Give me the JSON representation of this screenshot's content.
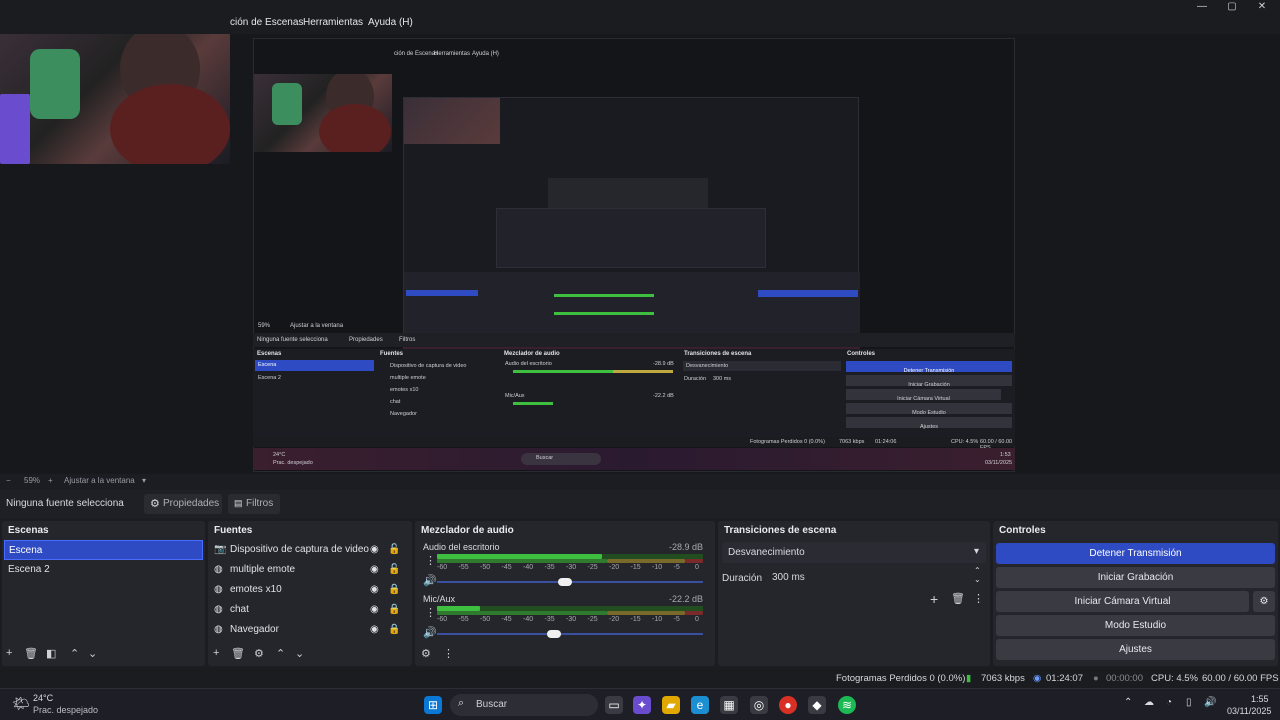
{
  "menu": {
    "item_scenes": "ción de Escenas",
    "item_tools": "Herramientas",
    "item_help": "Ayuda (H)"
  },
  "window_controls": {
    "minimize": "—",
    "maximize": "▢",
    "close": "✕"
  },
  "nested_preview": {
    "menu_scenes": "ción de Escenas",
    "menu_tools": "Herramientas",
    "menu_help": "Ayuda (H)",
    "zoom": "59%",
    "fit": "Ajustar a la ventana",
    "no_source": "Ninguna fuente selecciona",
    "properties": "Propiedades",
    "filters": "Filtros",
    "scenes_title": "Escenas",
    "scene1": "Escena",
    "scene2": "Escena 2",
    "sources_title": "Fuentes",
    "sources": [
      "Dispositivo de captura de video",
      "multiple emote",
      "emotes x10",
      "chat",
      "Navegador"
    ],
    "mixer_title": "Mezclador de audio",
    "desktop_audio": "Audio del escritorio",
    "desktop_db": "-28.9 dB",
    "mic": "Mic/Aux",
    "mic_db": "-22.2 dB",
    "transitions_title": "Transiciones de escena",
    "transition": "Desvanecimiento",
    "duration_label": "Duración",
    "duration": "300 ms",
    "controls_title": "Controles",
    "buttons": [
      "Detener Transmisión",
      "Iniciar Grabación",
      "Iniciar Cámara Virtual",
      "Modo Estudio",
      "Ajustes"
    ],
    "status": "Fotogramas Perdidos 0 (0.0%)",
    "kbps": "7063 kbps",
    "time": "01:24:06",
    "cpu": "CPU: 4.5%",
    "fps": "60.00 / 60.00 FPS",
    "weather_temp": "24°C",
    "weather_desc": "Prac. despejado",
    "search": "Buscar",
    "clock": "1:53",
    "date": "03/11/2025"
  },
  "zoombar": {
    "zoom": "59%",
    "fit": "Ajustar a la ventana"
  },
  "propbar": {
    "no_source": "Ninguna fuente selecciona",
    "properties": "Propiedades",
    "filters": "Filtros"
  },
  "scenes": {
    "title": "Escenas",
    "items": [
      "Escena",
      "Escena 2"
    ]
  },
  "sources": {
    "title": "Fuentes",
    "items": [
      "Dispositivo de captura de video",
      "multiple emote",
      "emotes x10",
      "chat",
      "Navegador"
    ]
  },
  "mixer": {
    "title": "Mezclador de audio",
    "desktop": {
      "name": "Audio del escritorio",
      "db": "-28.9 dB",
      "level": 0.62,
      "volume": 0.48
    },
    "mic": {
      "name": "Mic/Aux",
      "db": "-22.2 dB",
      "level": 0.16,
      "volume": 0.44
    },
    "ticks": [
      "-60",
      "-55",
      "-50",
      "-45",
      "-40",
      "-35",
      "-30",
      "-25",
      "-20",
      "-15",
      "-10",
      "-5",
      "0"
    ]
  },
  "transitions": {
    "title": "Transiciones de escena",
    "selected": "Desvanecimiento",
    "duration_label": "Duración",
    "duration": "300 ms"
  },
  "controls": {
    "title": "Controles",
    "stop_stream": "Detener Transmisión",
    "start_recording": "Iniciar Grabación",
    "start_virtual_cam": "Iniciar Cámara Virtual",
    "studio_mode": "Modo Estudio",
    "settings": "Ajustes"
  },
  "status": {
    "dropped_frames": "Fotogramas Perdidos 0 (0.0%)",
    "kbps": "7063 kbps",
    "stream_time": "01:24:07",
    "rec_time": "00:00:00",
    "cpu": "CPU: 4.5%",
    "fps": "60.00 / 60.00 FPS"
  },
  "taskbar": {
    "weather_temp": "24°C",
    "weather_desc": "Prac. despejado",
    "search_placeholder": "Buscar",
    "clock": "1:55",
    "date": "03/11/2025"
  },
  "colors": {
    "accent": "#2e4bc4",
    "meter_green": "#3fbf3f",
    "meter_yellow": "#bfa83f",
    "meter_red": "#c03f3f"
  }
}
